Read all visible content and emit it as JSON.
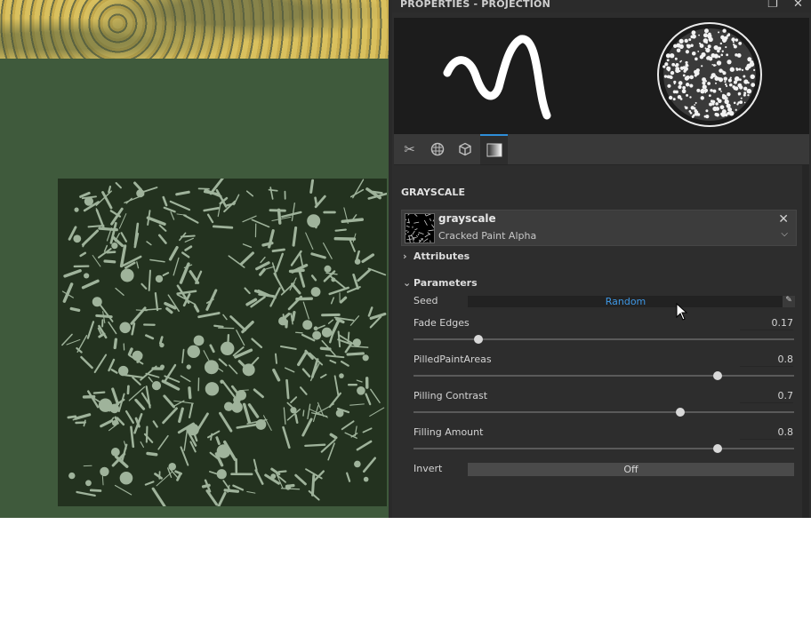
{
  "panel": {
    "title": "PROPERTIES - PROJECTION"
  },
  "window_controls": {
    "maximize": "maximize-icon",
    "close": "close-icon"
  },
  "tabs": [
    {
      "icon": "brush-icon"
    },
    {
      "icon": "material-sphere-icon"
    },
    {
      "icon": "cube-icon"
    },
    {
      "icon": "grayscale-gradient-icon",
      "active": true
    }
  ],
  "section_title": "GRAYSCALE",
  "resource": {
    "name": "grayscale",
    "subtitle": "Cracked Paint Alpha"
  },
  "groups": {
    "attributes": "Attributes",
    "parameters": "Parameters"
  },
  "params": {
    "seed": {
      "label": "Seed",
      "value": "Random"
    },
    "fade_edges": {
      "label": "Fade Edges",
      "value": "0.17",
      "fraction": 0.17
    },
    "pilled_paint_areas": {
      "label": "PilledPaintAreas",
      "value": "0.8",
      "fraction": 0.8
    },
    "pilling_contrast": {
      "label": "Pilling Contrast",
      "value": "0.7",
      "fraction": 0.7
    },
    "filling_amount": {
      "label": "Filling Amount",
      "value": "0.8",
      "fraction": 0.8
    },
    "invert": {
      "label": "Invert",
      "value": "Off"
    }
  },
  "colors": {
    "accent": "#2e8ed8",
    "seed_text": "#3e97e4",
    "viewport_green": "#3f5a3c"
  }
}
